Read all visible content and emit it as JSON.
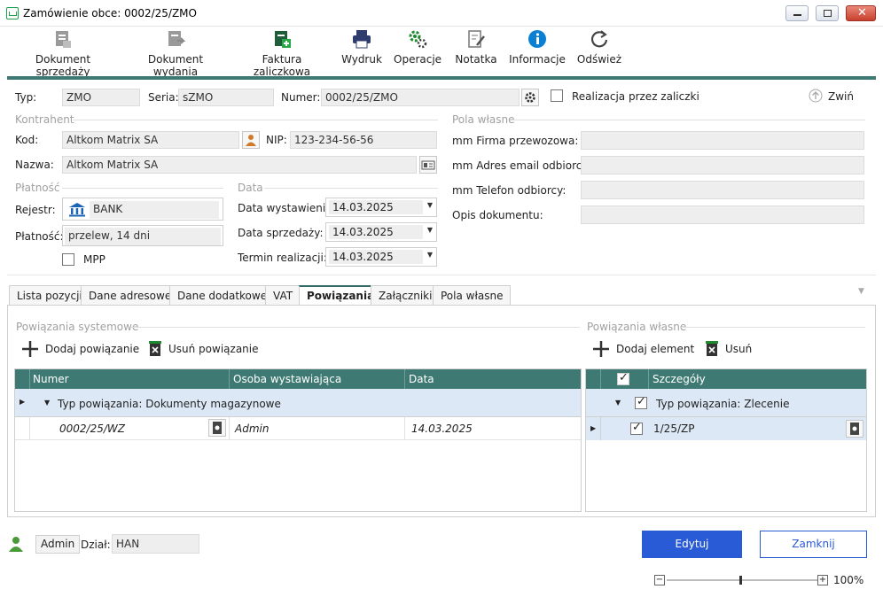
{
  "window": {
    "title": "Zamówienie obce: 0002/25/ZMO"
  },
  "toolbar": {
    "items": [
      {
        "label": "Dokument sprzedaży",
        "icon": "document-sale-icon"
      },
      {
        "label": "Dokument wydania",
        "icon": "document-issue-icon"
      },
      {
        "label": "Faktura zaliczkowa",
        "icon": "advance-invoice-icon"
      },
      {
        "label": "Wydruk",
        "icon": "printer-icon"
      },
      {
        "label": "Operacje",
        "icon": "gears-icon"
      },
      {
        "label": "Notatka",
        "icon": "note-icon"
      },
      {
        "label": "Informacje",
        "icon": "info-icon"
      },
      {
        "label": "Odśwież",
        "icon": "refresh-icon"
      }
    ]
  },
  "header": {
    "typ_label": "Typ:",
    "typ_value": "ZMO",
    "seria_label": "Seria:",
    "seria_value": "sZMO",
    "numer_label": "Numer:",
    "numer_value": "0002/25/ZMO",
    "realizacja_label": "Realizacja przez zaliczki",
    "collapse_label": "Zwiń"
  },
  "kontrahent": {
    "group_label": "Kontrahent",
    "kod_label": "Kod:",
    "kod_value": "Altkom Matrix SA",
    "nip_label": "NIP:",
    "nip_value": "123-234-56-56",
    "nazwa_label": "Nazwa:",
    "nazwa_value": "Altkom Matrix SA"
  },
  "pola_wlasne": {
    "group_label": "Pola własne",
    "fields": [
      {
        "label": "mm Firma przewozowa:",
        "value": ""
      },
      {
        "label": "mm Adres email odbiorcy:",
        "value": ""
      },
      {
        "label": "mm Telefon odbiorcy:",
        "value": ""
      },
      {
        "label": "Opis dokumentu:",
        "value": ""
      }
    ]
  },
  "platnosc": {
    "group_label": "Płatność",
    "rejestr_label": "Rejestr:",
    "rejestr_value": "BANK",
    "platnosc_label": "Płatność:",
    "platnosc_value": "przelew, 14 dni",
    "mpp_label": "MPP"
  },
  "data": {
    "group_label": "Data",
    "wystawienia_label": "Data wystawienia:",
    "wystawienia_value": "14.03.2025",
    "sprzedazy_label": "Data sprzedaży:",
    "sprzedazy_value": "14.03.2025",
    "termin_label": "Termin realizacji:",
    "termin_value": "14.03.2025"
  },
  "tabs": [
    "Lista pozycji",
    "Dane adresowe",
    "Dane dodatkowe",
    "VAT",
    "Powiązania",
    "Załączniki",
    "Pola własne"
  ],
  "active_tab": "Powiązania",
  "system_links": {
    "group_label": "Powiązania systemowe",
    "add_label": "Dodaj powiązanie",
    "remove_label": "Usuń powiązanie",
    "columns": [
      "Numer",
      "Osoba wystawiająca",
      "Data"
    ],
    "group_row": "Typ powiązania: Dokumenty magazynowe",
    "rows": [
      {
        "numer": "0002/25/WZ",
        "osoba": "Admin",
        "data": "14.03.2025"
      }
    ]
  },
  "own_links": {
    "group_label": "Powiązania własne",
    "add_label": "Dodaj element",
    "remove_label": "Usuń",
    "column": "Szczegóły",
    "group_row": "Typ powiązania: Zlecenie",
    "rows": [
      {
        "value": "1/25/ZP"
      }
    ]
  },
  "footer": {
    "user": "Admin",
    "dzial_label": "Dział:",
    "dzial_value": "HAN",
    "edit_label": "Edytuj",
    "close_label": "Zamknij",
    "zoom": "100%"
  },
  "colors": {
    "accent": "#3e7a73",
    "primary_button": "#2a5bd7",
    "selection": "#dde8f6"
  }
}
